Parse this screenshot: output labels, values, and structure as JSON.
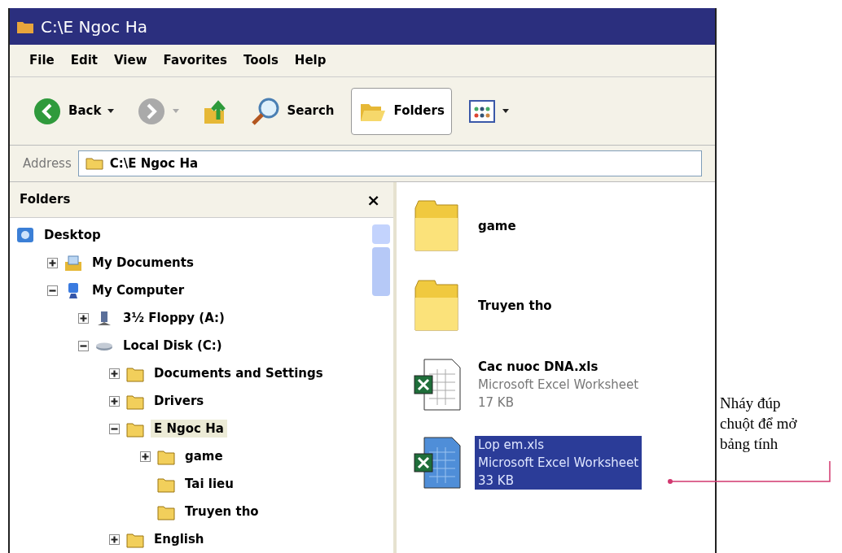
{
  "window": {
    "title": "C:\\E Ngoc Ha"
  },
  "menu": [
    "File",
    "Edit",
    "View",
    "Favorites",
    "Tools",
    "Help"
  ],
  "toolbar": [
    {
      "kind": "back",
      "label": "Back"
    },
    {
      "kind": "forward"
    },
    {
      "kind": "up"
    },
    {
      "kind": "search",
      "label": "Search"
    },
    {
      "kind": "folders",
      "label": "Folders",
      "selected": true
    },
    {
      "kind": "views"
    }
  ],
  "address": {
    "label": "Address",
    "value": "C:\\E Ngoc Ha"
  },
  "folders_pane": {
    "title": "Folders",
    "close": "×",
    "tree": [
      {
        "label": "Desktop",
        "kind": "desktop",
        "expandable": false,
        "selected": false,
        "children": [
          {
            "label": "My Documents",
            "kind": "documents",
            "expandable": true,
            "expanded": false,
            "selected": false
          },
          {
            "label": "My Computer",
            "kind": "computer",
            "expandable": true,
            "expanded": true,
            "selected": false,
            "children": [
              {
                "label": "3½ Floppy (A:)",
                "kind": "floppy",
                "expandable": true,
                "expanded": false,
                "selected": false
              },
              {
                "label": "Local Disk (C:)",
                "kind": "disk",
                "expandable": true,
                "expanded": true,
                "selected": false,
                "children": [
                  {
                    "label": "Documents and Settings",
                    "kind": "folder",
                    "expandable": true,
                    "expanded": false,
                    "selected": false
                  },
                  {
                    "label": "Drivers",
                    "kind": "folder",
                    "expandable": true,
                    "expanded": false,
                    "selected": false
                  },
                  {
                    "label": "E Ngoc Ha",
                    "kind": "folder",
                    "expandable": true,
                    "expanded": true,
                    "selected": true,
                    "children": [
                      {
                        "label": "game",
                        "kind": "folder",
                        "expandable": true,
                        "expanded": false,
                        "selected": false
                      },
                      {
                        "label": "Tai lieu",
                        "kind": "folder",
                        "expandable": false,
                        "expanded": false,
                        "selected": false
                      },
                      {
                        "label": "Truyen tho",
                        "kind": "folder",
                        "expandable": false,
                        "expanded": false,
                        "selected": false
                      }
                    ]
                  },
                  {
                    "label": "English",
                    "kind": "folder",
                    "expandable": true,
                    "expanded": false,
                    "selected": false
                  }
                ]
              }
            ]
          }
        ]
      }
    ]
  },
  "files": [
    {
      "kind": "folder",
      "name": "game",
      "selected": false
    },
    {
      "kind": "folder",
      "name": "Truyen tho",
      "selected": false
    },
    {
      "kind": "excel",
      "name": "Cac nuoc DNA.xls",
      "type": "Microsoft Excel Worksheet",
      "size": "17 KB",
      "selected": false
    },
    {
      "kind": "excel",
      "name": "Lop em.xls",
      "type": "Microsoft Excel Worksheet",
      "size": "33 KB",
      "selected": true
    }
  ],
  "annotation": {
    "lines": [
      "Nháy đúp",
      "chuột để mở",
      "bảng tính"
    ]
  }
}
